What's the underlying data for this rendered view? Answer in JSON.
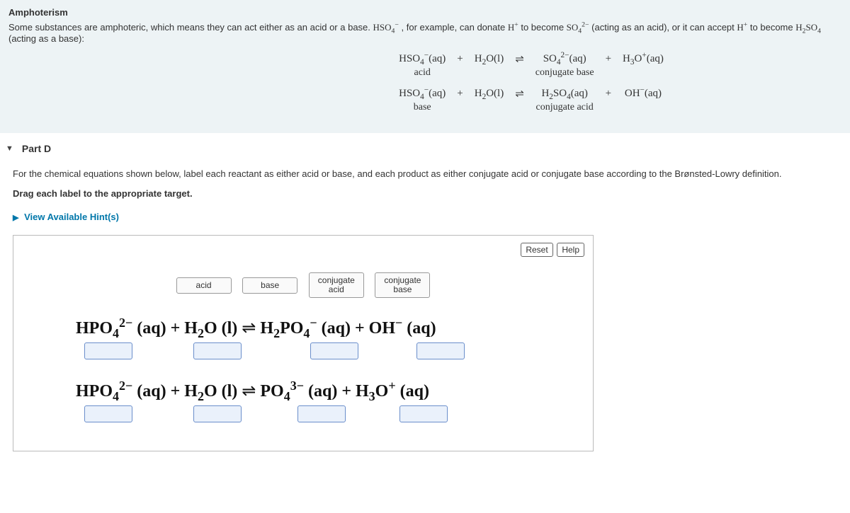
{
  "intro": {
    "title": "Amphoterism",
    "text_a": "Some substances are amphoteric, which means they can act either as an acid or a base. ",
    "text_b": ", for example, can donate ",
    "text_c": " to become ",
    "text_d": " (acting as an acid), or it can accept ",
    "text_e": " to become ",
    "text_f": " (acting as a base):",
    "eq1": {
      "r1": "HSO",
      "r1_phase": "(aq)",
      "plus1": "+",
      "r2": "H",
      "r2_rest": "O(l)",
      "arrow": "⇌",
      "p1": "SO",
      "p1_phase": "(aq)",
      "plus2": "+",
      "p2": "H",
      "p2_rest": "O",
      "p2_phase": "(aq)",
      "lbl_acid": "acid",
      "lbl_cb": "conjugate base"
    },
    "eq2": {
      "lbl_base": "base",
      "lbl_ca": "conjugate acid",
      "p1": "H",
      "p1_rest": "SO",
      "p1_phase": "(aq)",
      "p2": "OH",
      "p2_phase": "(aq)"
    }
  },
  "part": {
    "label": "Part D",
    "line1": "For the chemical equations shown below, label each reactant as either acid or base, and each product as either conjugate acid or conjugate base according to the Brønsted-Lowry definition.",
    "line2": "Drag each label to the appropriate target.",
    "hints": "View Available Hint(s)"
  },
  "buttons": {
    "reset": "Reset",
    "help": "Help"
  },
  "labels": {
    "acid": "acid",
    "base": "base",
    "conj_acid": "conjugate\nacid",
    "conj_base": "conjugate\nbase"
  }
}
